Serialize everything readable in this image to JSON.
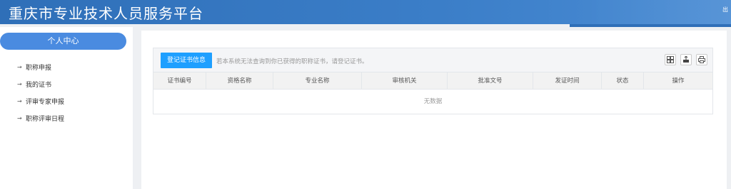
{
  "header": {
    "title": "重庆市专业技术人员服务平台",
    "right_mark": "出"
  },
  "sidebar": {
    "center_label": "个人中心",
    "items": [
      {
        "label": "职称申报"
      },
      {
        "label": "我的证书"
      },
      {
        "label": "评审专家申报"
      },
      {
        "label": "职称评审日程"
      }
    ]
  },
  "main": {
    "register_button": "登记证书信息",
    "hint": "若本系统无法查询到你已获得的职称证书，请登记证书。",
    "toolbar_icons": [
      "grid-columns-icon",
      "export-icon",
      "print-icon"
    ],
    "table": {
      "columns": [
        "证书编号",
        "资格名称",
        "专业名称",
        "审核机关",
        "批准文号",
        "发证时间",
        "状态",
        "操作"
      ],
      "empty_text": "无数据"
    }
  },
  "colors": {
    "header": "#2f6fb8",
    "accent_button": "#1e9fff",
    "sidebar_pill": "#4a8be0"
  }
}
